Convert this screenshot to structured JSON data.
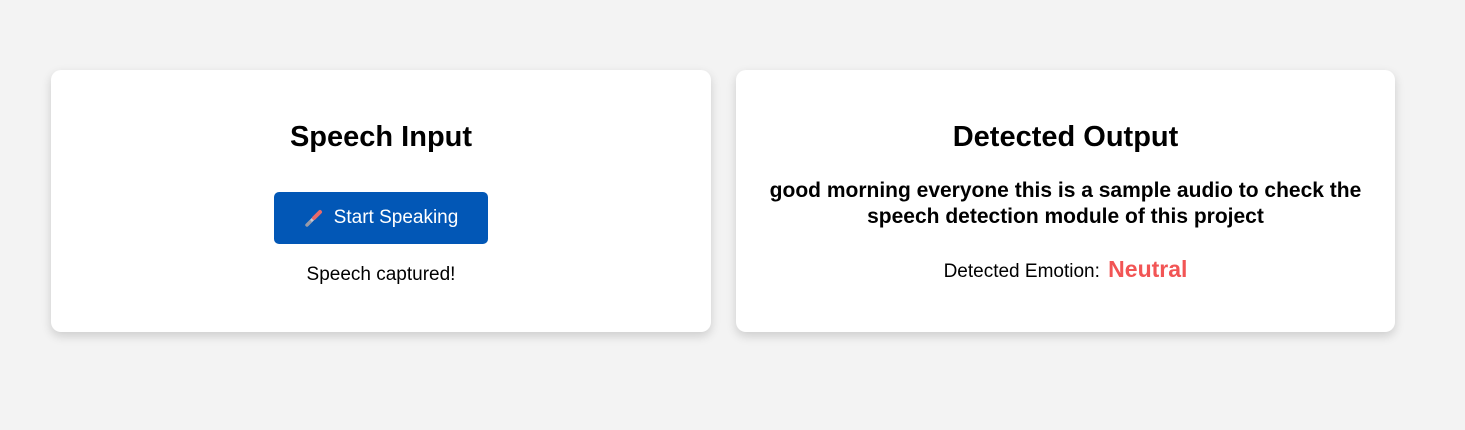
{
  "colors": {
    "page_background": "#f3f3f3",
    "card_background": "#ffffff",
    "button_primary": "#0257b6",
    "emotion_accent": "#f25555"
  },
  "input_panel": {
    "title": "Speech Input",
    "button_label": "Start Speaking",
    "button_icon": "microphone-icon",
    "status": "Speech captured!"
  },
  "output_panel": {
    "title": "Detected Output",
    "transcript": "good morning everyone this is a sample audio to check the speech detection module of this project",
    "emotion_label": "Detected Emotion:",
    "emotion_value": "Neutral"
  }
}
